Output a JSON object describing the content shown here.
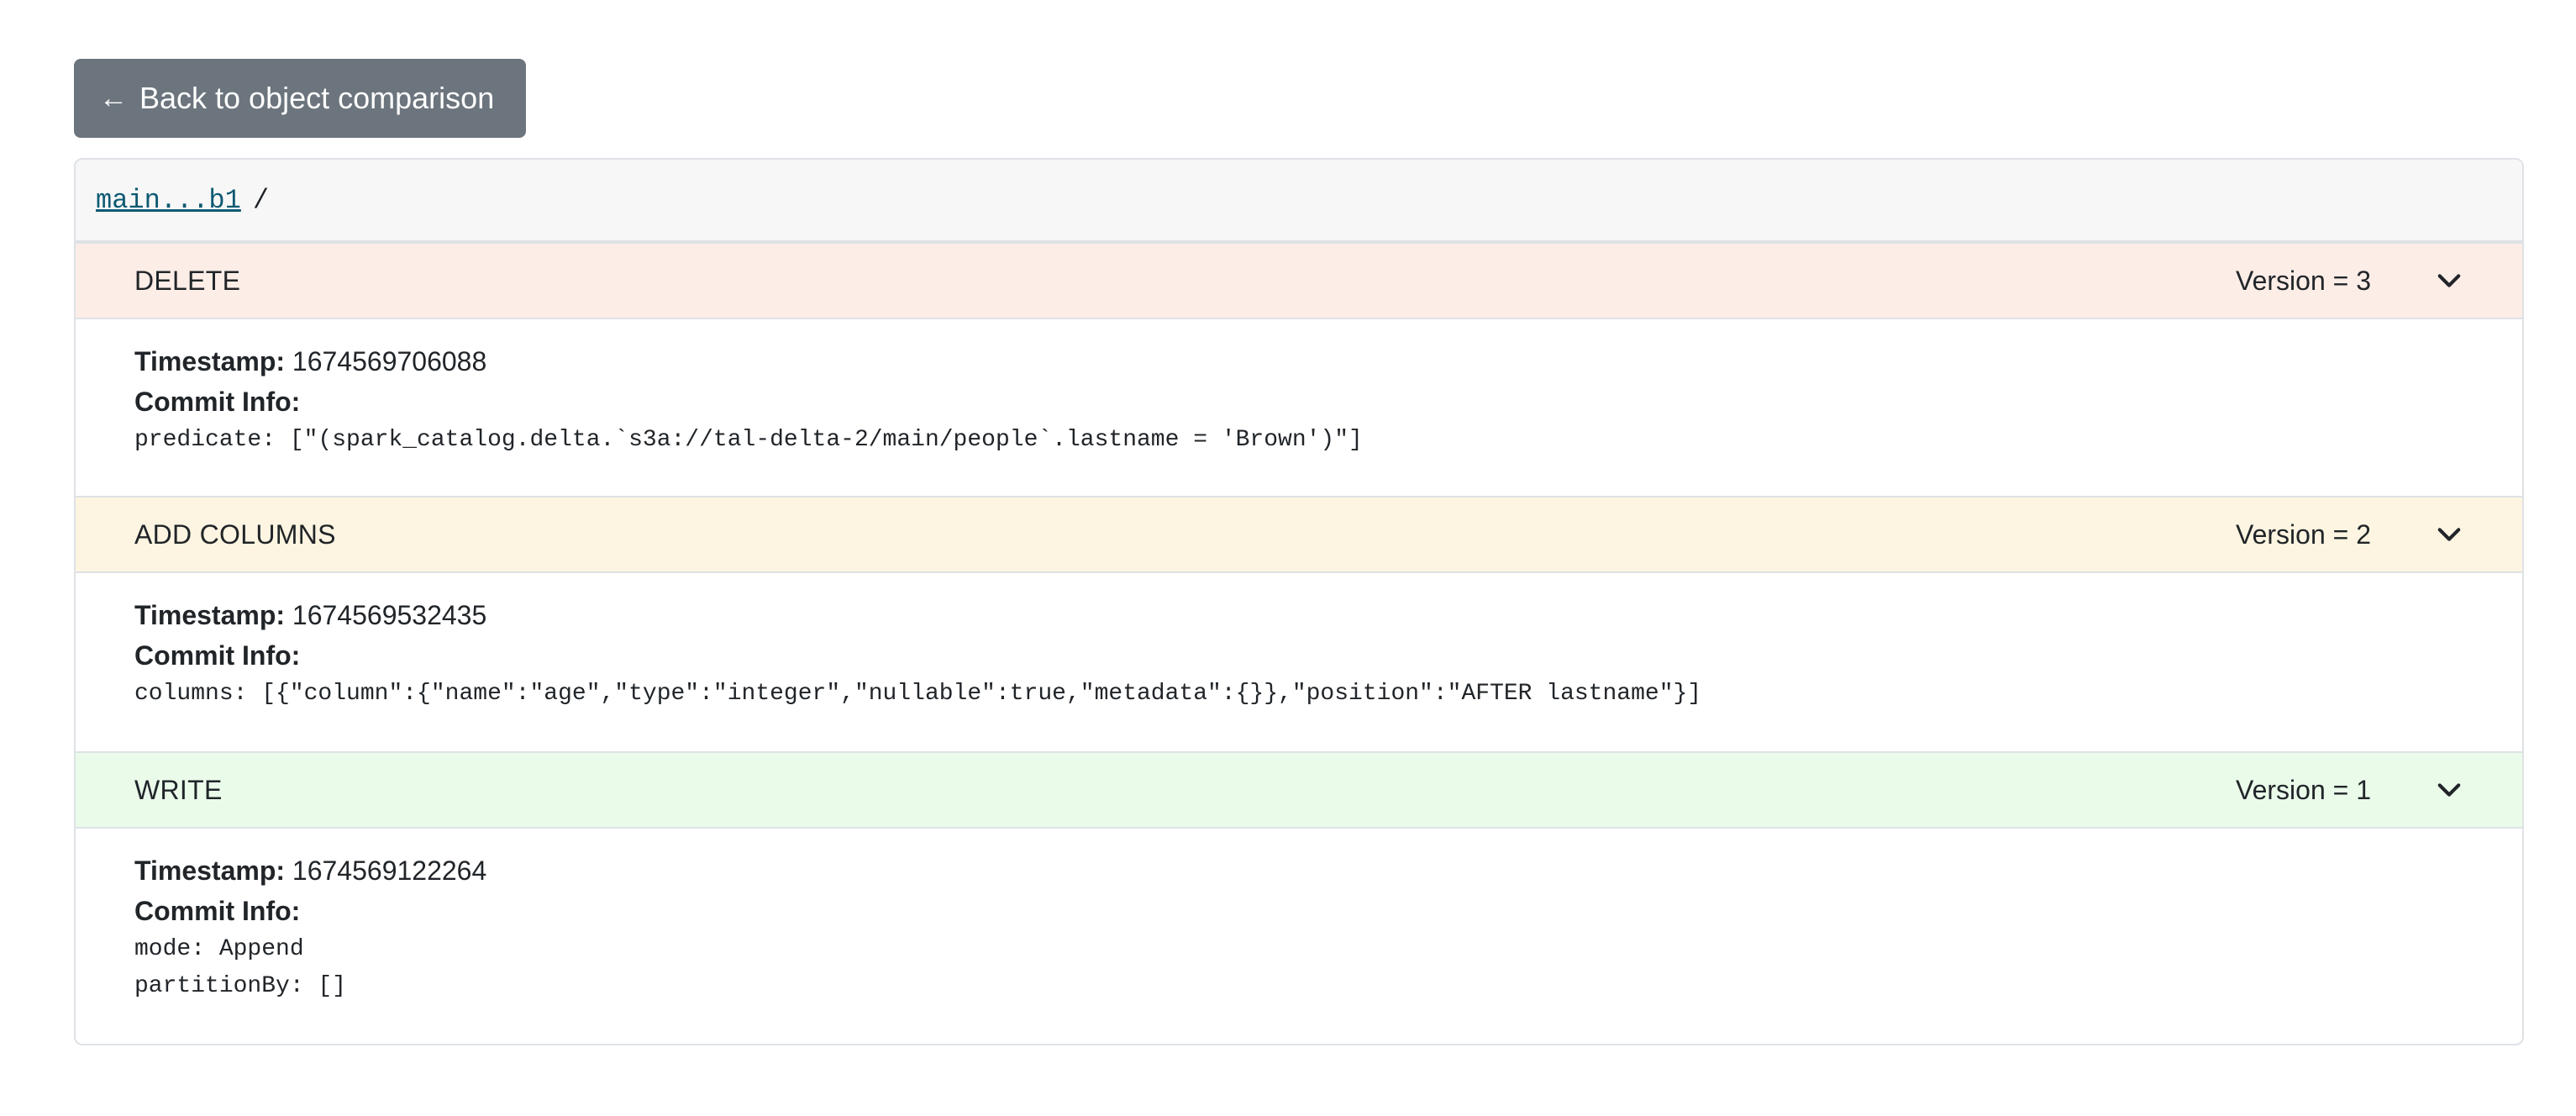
{
  "back_button": {
    "arrow": "←",
    "label": "Back to object comparison"
  },
  "breadcrumb": {
    "ref": "main...b1",
    "separator": "/"
  },
  "labels": {
    "timestamp": "Timestamp:",
    "commit_info": "Commit Info:"
  },
  "entries": [
    {
      "operation": "DELETE",
      "version": "Version = 3",
      "timestamp": "1674569706088",
      "commit_lines": [
        "predicate: [\"(spark_catalog.delta.`s3a://tal-delta-2/main/people`.lastname = 'Brown')\"]"
      ]
    },
    {
      "operation": "ADD COLUMNS",
      "version": "Version = 2",
      "timestamp": "1674569532435",
      "commit_lines": [
        "columns: [{\"column\":{\"name\":\"age\",\"type\":\"integer\",\"nullable\":true,\"metadata\":{}},\"position\":\"AFTER lastname\"}]"
      ]
    },
    {
      "operation": "WRITE",
      "version": "Version = 1",
      "timestamp": "1674569122264",
      "commit_lines": [
        "mode: Append",
        "partitionBy: []"
      ]
    }
  ],
  "colors": {
    "delete_bg": "#fdede7",
    "add_bg": "#fdf5e1",
    "write_bg": "#eafbea",
    "button_bg": "#6c757d",
    "link": "#0d5a73"
  },
  "icons": {
    "back": "arrow-left-icon",
    "toggle": "chevron-down-icon"
  }
}
